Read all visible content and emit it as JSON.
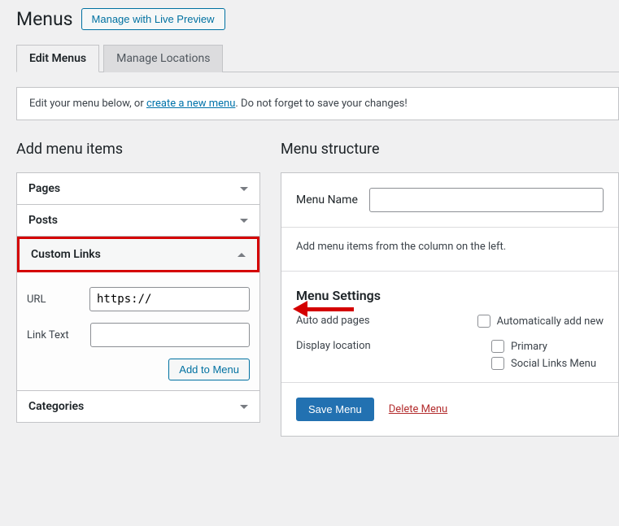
{
  "header": {
    "title": "Menus",
    "preview_btn": "Manage with Live Preview"
  },
  "tabs": {
    "edit": "Edit Menus",
    "manage": "Manage Locations"
  },
  "notice": {
    "pre": "Edit your menu below, or ",
    "link": "create a new menu",
    "post": ". Do not forget to save your changes!"
  },
  "left": {
    "heading": "Add menu items",
    "items": {
      "pages": "Pages",
      "posts": "Posts",
      "custom": "Custom Links",
      "categories": "Categories"
    },
    "custom_form": {
      "url_label": "URL",
      "url_value": "https://",
      "text_label": "Link Text",
      "text_value": "",
      "add_btn": "Add to Menu"
    }
  },
  "right": {
    "heading": "Menu structure",
    "menu_name_label": "Menu Name",
    "menu_name_value": "",
    "hint": "Add menu items from the column on the left.",
    "settings_heading": "Menu Settings",
    "auto_label": "Auto add pages",
    "auto_check": "Automatically add new",
    "display_label": "Display location",
    "loc_primary": "Primary",
    "loc_social": "Social Links Menu",
    "save_btn": "Save Menu",
    "delete_link": "Delete Menu"
  }
}
